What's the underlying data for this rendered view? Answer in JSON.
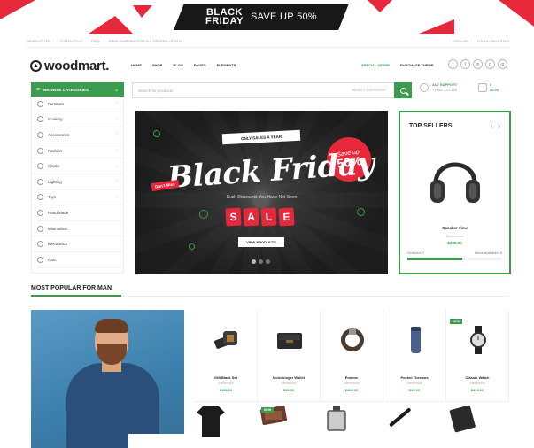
{
  "promo": {
    "line1": "BLACK",
    "line2": "FRIDAY",
    "offer": "SAVE UP 50%"
  },
  "topbar": {
    "left": [
      "NEWSLETTER",
      "CONTACT US",
      "FAQs",
      "FREE SHIPPING FOR ALL ORDERS OF $150"
    ],
    "right": [
      "ENGLISH",
      "LOGIN / REGISTER"
    ]
  },
  "header": {
    "logo_text": "woodmart.",
    "nav": [
      "HOME",
      "SHOP",
      "BLOG",
      "PAGES",
      "ELEMENTS"
    ],
    "special": "SPECIAL OFFER",
    "purchase": "PURCHASE THEME",
    "socials": [
      "f",
      "t",
      "in",
      "p",
      "ig"
    ]
  },
  "categories": {
    "title": "BROWSE CATEGORIES",
    "items": [
      "Furniture",
      "Cooking",
      "Accessories",
      "Fashion",
      "Clocks",
      "Lighting",
      "Toys",
      "Hand Made",
      "Minimalism",
      "Electronics",
      "Cars"
    ]
  },
  "search": {
    "placeholder": "Search for products",
    "category": "SELECT CATEGORY"
  },
  "support": {
    "label": "24/7 SUPPORT",
    "phone": "+1 800 123 456"
  },
  "cart": {
    "count": "0",
    "total": "$0.00"
  },
  "hero": {
    "tag": "ONLY SALES A YEAR",
    "headline": "Black Friday",
    "limited": "Don't Miss",
    "circle_top": "Save up",
    "circle_value": "50%",
    "subtitle": "Such Discounts You Have Not Seen",
    "sale_letters": [
      "S",
      "A",
      "L",
      "E"
    ],
    "button": "VIEW PRODUCTS"
  },
  "top_sellers": {
    "title": "TOP SELLERS",
    "prev": "‹",
    "next": "›",
    "product": {
      "name": "Speaker view",
      "category": "Electronics",
      "price": "$299.00",
      "ordered": "Ordered: 7",
      "available": "Items available: 5",
      "progress": 0.58
    }
  },
  "popular": {
    "title": "MOST POPULAR FOR MAN",
    "products": [
      {
        "name": "Gift Black Set",
        "category": "Electronics",
        "price": "$199.00",
        "badge": "",
        "icon": "gift-set"
      },
      {
        "name": "Moleskinger Wallet",
        "category": "Electronics",
        "price": "$39.00",
        "badge": "",
        "icon": "wallet"
      },
      {
        "name": "Pomme",
        "category": "Electronics",
        "price": "$129.00",
        "badge": "",
        "icon": "belt"
      },
      {
        "name": "Pocket Thermos",
        "category": "Electronics",
        "price": "$99.00",
        "badge": "",
        "icon": "thermos"
      },
      {
        "name": "Classic Watch",
        "category": "Electronics",
        "price": "$219.00",
        "badge": "NEW",
        "icon": "watch"
      }
    ],
    "row2": [
      {
        "badge": "",
        "icon": "shirt"
      },
      {
        "badge": "NEW",
        "icon": "leather-case"
      },
      {
        "badge": "",
        "icon": "perfume"
      },
      {
        "badge": "",
        "icon": "pen"
      },
      {
        "badge": "",
        "icon": "notebook"
      }
    ]
  },
  "colors": {
    "accent": "#3a9c4e",
    "promo_red": "#e7283b",
    "dark": "#1c1c1c"
  }
}
